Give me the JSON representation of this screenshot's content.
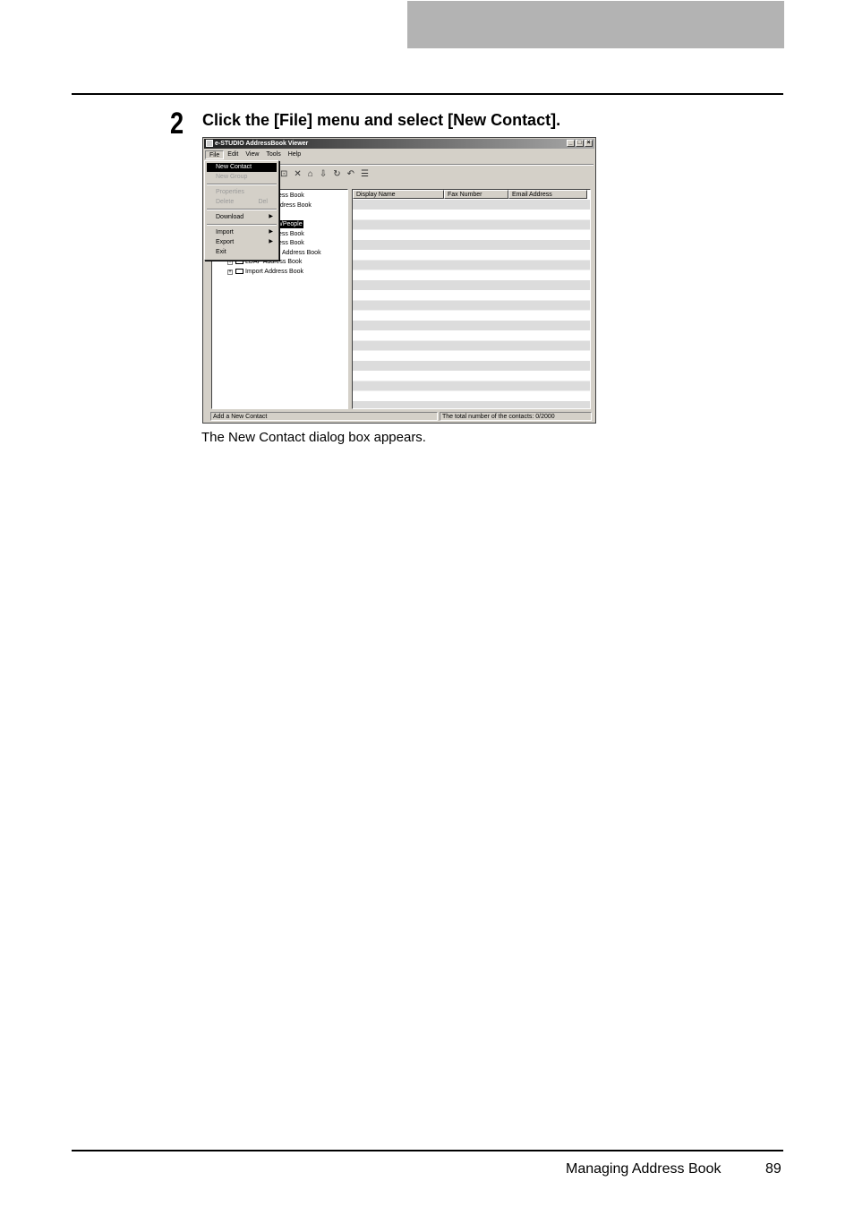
{
  "step": {
    "number": "2",
    "instruction": "Click the [File] menu and select [New Contact]."
  },
  "caption": "The New Contact dialog box appears.",
  "footer": {
    "section_title": "Managing Address Book",
    "page_number": "89"
  },
  "app": {
    "window_title": "e-STUDIO AddressBook Viewer",
    "window_buttons": [
      "_",
      "□",
      "×"
    ],
    "menu": [
      "File",
      "Edit",
      "View",
      "Tools",
      "Help"
    ],
    "file_menu": {
      "new_contact": "New Contact",
      "new_group": "New Group",
      "properties": "Properties",
      "delete": "Delete",
      "delete_shortcut": "Del",
      "download": "Download",
      "import": "Import",
      "export": "Export",
      "exit": "Exit"
    },
    "tree": [
      {
        "label": "ess Book"
      },
      {
        "label": "ddress Book"
      },
      {
        "label": "n/People"
      },
      {
        "label": "ess Book"
      },
      {
        "label": "ess Book"
      },
      {
        "label": "Address Book"
      },
      {
        "label": "Address Book",
        "prefix": "LDAP"
      },
      {
        "label": "Import Address Book"
      }
    ],
    "list_columns": [
      "Display Name",
      "Fax Number",
      "Email Address"
    ],
    "status": {
      "left": "Add a New Contact",
      "right": "The total number of the contacts: 0/2000"
    }
  }
}
